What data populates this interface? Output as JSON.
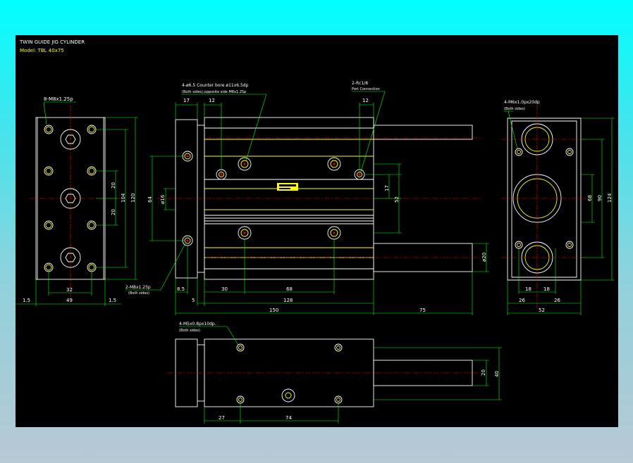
{
  "title": {
    "line1": "TWIN GUIDE JIG CYLINDER",
    "line2": "Model: TBL 40x75"
  },
  "colors": {
    "background_top": "#00ffff",
    "canvas": "#000000",
    "outline": "#ffffff",
    "hidden": "#ffff00",
    "dimension": "#00ff00",
    "centerline": "#ff0000"
  },
  "left_view": {
    "callout": "8-M8x1.25p",
    "dims": {
      "d20a": "20",
      "d20b": "20",
      "d104": "104",
      "d120": "120",
      "d32": "32",
      "d49": "49",
      "d15a": "1.5",
      "d15b": "1.5"
    }
  },
  "front_view": {
    "callout_counterbore_1": "4-ø6.5  Counter bore ø11x6.5dp",
    "callout_counterbore_2": "(Both sides),opposite side M8x1.25p",
    "callout_port_1": "2-Rc1/8",
    "callout_port_2": "Port Connection",
    "callout_bottom_1": "2-M8x1.25p",
    "callout_bottom_2": "(Both sides)",
    "dims": {
      "d17": "17",
      "d12a": "12",
      "d12b": "12",
      "d64": "64",
      "d16": "ø16",
      "d17v": "17",
      "d52": "52",
      "d20": "ø20",
      "d85": "8.5",
      "d30": "30",
      "d68": "68",
      "d5": "5",
      "d128": "128",
      "d150": "150",
      "d75": "75"
    }
  },
  "right_view": {
    "callout_1": "4-M6x1.0px20dp",
    "callout_2": "(Both sides)",
    "dims": {
      "d68": "68",
      "d90": "90",
      "d124": "124",
      "d18a": "18",
      "d18b": "18",
      "d26a": "26",
      "d26b": "26",
      "d52": "52"
    }
  },
  "bottom_view": {
    "callout_1": "4-M5x0.8px10dp.",
    "callout_2": "(Both sides)",
    "dims": {
      "d20": "20",
      "d40": "40",
      "d27": "27",
      "d74": "74"
    }
  }
}
